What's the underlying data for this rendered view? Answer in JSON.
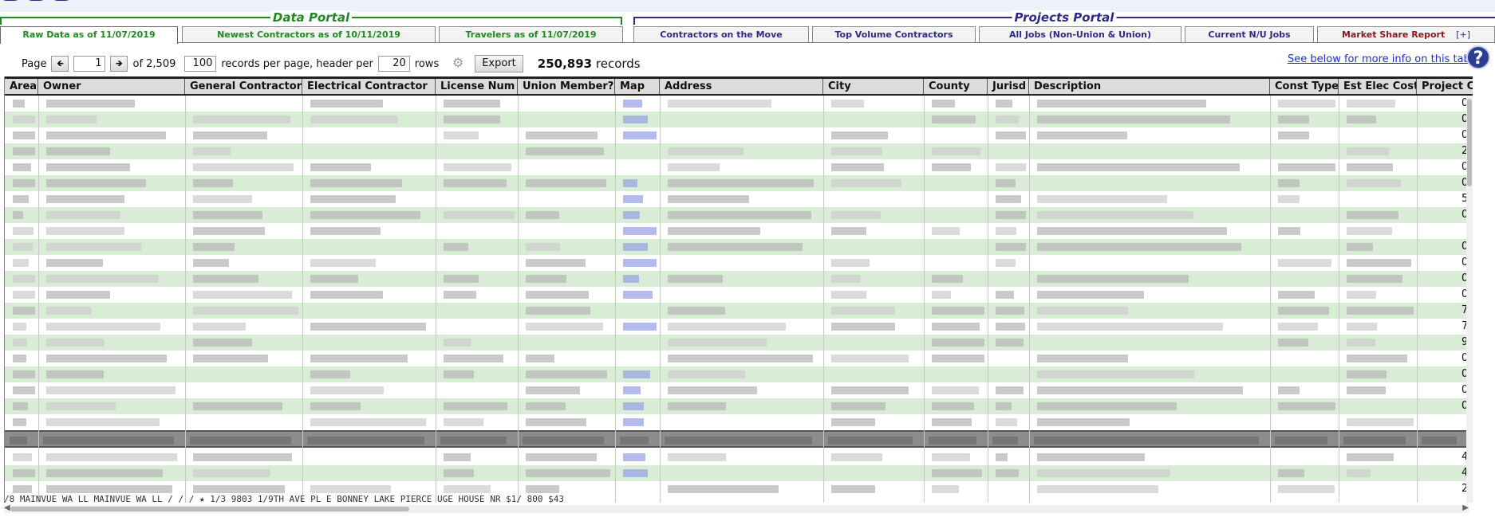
{
  "portals": {
    "data_portal": "Data Portal",
    "projects_portal": "Projects Portal"
  },
  "tabs": [
    {
      "label": "Raw Data as of 11/07/2019",
      "color": "green",
      "active": true
    },
    {
      "label": "Newest Contractors as of 10/11/2019",
      "color": "green"
    },
    {
      "label": "Travelers as of 11/07/2019",
      "color": "green"
    },
    {
      "label": "Contractors on the Move",
      "color": "blue"
    },
    {
      "label": "Top Volume Contractors",
      "color": "blue"
    },
    {
      "label": "All Jobs (Non-Union & Union)",
      "color": "blue"
    },
    {
      "label": "Current N/U Jobs",
      "color": "blue"
    },
    {
      "label": "Market Share Report",
      "color": "red",
      "extra": "[+]"
    }
  ],
  "toolbar": {
    "page_label": "Page",
    "prev_icon": "arrow-left-icon",
    "page_value": "1",
    "next_icon": "arrow-right-icon",
    "of_pages": "of 2,509",
    "per_page_value": "100",
    "records_per_page_label": "records per page, header per",
    "header_per_value": "20",
    "rows_label": "rows",
    "gear_icon": "gear-icon",
    "export_label": "Export",
    "record_count": "250,893",
    "records_label": "records"
  },
  "info_link": "See below for more info on this tab",
  "help": "?",
  "columns": [
    "Area",
    "Owner",
    "General Contractor",
    "Electrical Contractor",
    "License Num",
    "Union Member?",
    "Map",
    "Address",
    "City",
    "County",
    "Jurisd",
    "Description",
    "Const Type",
    "Est Elec Cost",
    "Project C"
  ],
  "last_col_values": [
    "0",
    "0",
    "0",
    "2",
    "0",
    "0",
    "5",
    "0",
    "",
    "0",
    "0",
    "0",
    "0",
    "7",
    "7",
    "9",
    "0",
    "0",
    "0",
    "0",
    "",
    "4",
    "4",
    "2"
  ],
  "bottom_partial_row": "/8  MAINVUE WA LL        MAINVUE WA LL   /                  /                  /   ★ 1/3    9803 1/9TH AVE PL E      BONNEY LAKE     PIERCE    UGE   HOUSE                    NR         $1/ 800     $43",
  "colors": {
    "green": "#1f8a1f",
    "blue": "#2e2a8a",
    "red": "#8a1a1a",
    "row_alt": "#d8ecd6",
    "link": "#1c2fd4"
  }
}
